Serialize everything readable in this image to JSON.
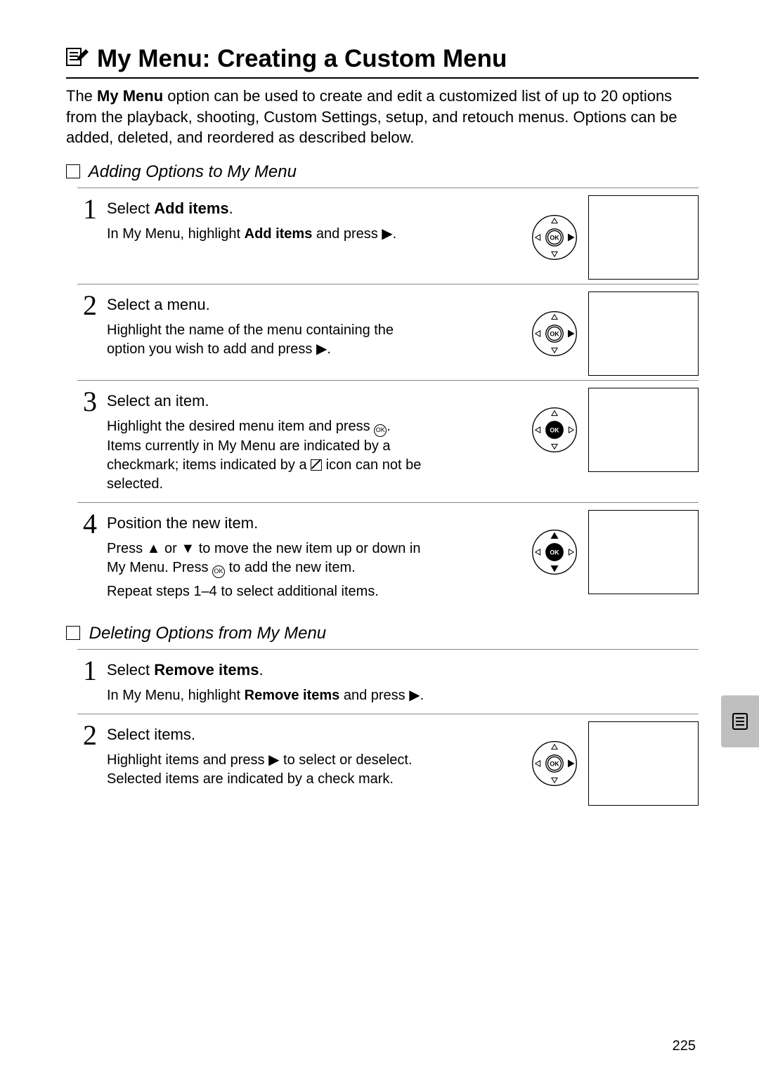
{
  "title": "My Menu: Creating a Custom Menu",
  "intro_pre": "The ",
  "intro_bold": "My Menu",
  "intro_post": " option can be used to create and edit a customized list of up to 20 options from the playback, shooting, Custom Settings, setup, and retouch menus. Options can be added, deleted, and reordered as described below.",
  "sectionA": "Adding Options to My Menu",
  "sectionB": "Deleting Options from My Menu",
  "addSteps": {
    "s1": {
      "num": "1",
      "heading_pre": "Select ",
      "heading_bold": "Add items",
      "heading_post": ".",
      "desc_pre": "In My Menu, highlight ",
      "desc_bold": "Add items",
      "desc_post": " and press ▶."
    },
    "s2": {
      "num": "2",
      "heading": "Select a menu.",
      "desc": "Highlight the name of the menu containing the option you wish to add and press ▶."
    },
    "s3": {
      "num": "3",
      "heading": "Select an item.",
      "desc_a": "Highlight the desired menu item and press ",
      "desc_b": ". Items currently in My Menu are indicated by a checkmark; items indicated by a ",
      "desc_c": " icon can not be selected."
    },
    "s4": {
      "num": "4",
      "heading": "Position the new item.",
      "desc1_a": "Press ▲ or ▼ to move the new item up or down in My Menu.  Press ",
      "desc1_b": " to add the new item.",
      "desc2": "Repeat steps 1–4 to select additional items."
    }
  },
  "delSteps": {
    "s1": {
      "num": "1",
      "heading_pre": "Select ",
      "heading_bold": "Remove items",
      "heading_post": ".",
      "desc_pre": "In My Menu, highlight ",
      "desc_bold": "Remove items",
      "desc_post": " and press ▶."
    },
    "s2": {
      "num": "2",
      "heading": "Select items.",
      "desc": "Highlight items and press ▶ to select or deselect.  Selected items are indicated by a check mark."
    }
  },
  "ok_label": "OK",
  "page_number": "225"
}
